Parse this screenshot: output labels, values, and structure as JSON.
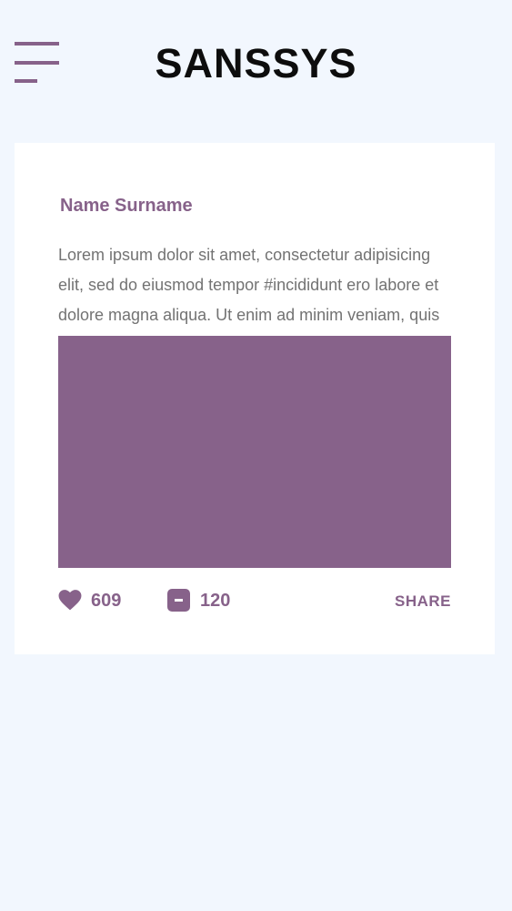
{
  "header": {
    "brand": "SANSSYS",
    "menu_icon": "hamburger-menu-icon"
  },
  "post": {
    "author": "Name Surname",
    "text": "Lorem ipsum dolor sit amet, consectetur adipisicing elit, sed do eiusmod tempor #incididunt ero labore et dolore magna aliqua. Ut enim ad minim veniam, quis",
    "image_color": "#87628a",
    "likes": "609",
    "comments": "120",
    "share_label": "SHARE",
    "like_icon": "heart-icon",
    "comment_icon": "comment-icon"
  },
  "colors": {
    "accent": "#87628a",
    "background": "#f2f7fe",
    "card": "#ffffff",
    "text": "#737373"
  }
}
